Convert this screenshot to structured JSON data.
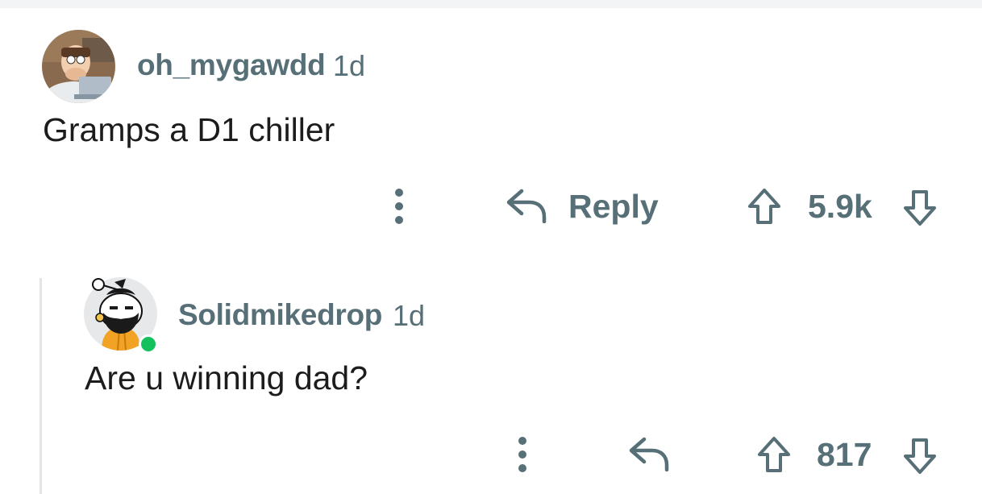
{
  "comments": [
    {
      "username": "oh_mygawdd",
      "time": "1d",
      "body": "Gramps a D1 chiller",
      "reply_label": "Reply",
      "score": "5.9k"
    },
    {
      "username": "Solidmikedrop",
      "time": "1d",
      "body": "Are u winning dad?",
      "score": "817",
      "online": true
    }
  ],
  "colors": {
    "meta_text": "#576f76",
    "body_text": "#1c1c1c",
    "thread_line": "#e3e6e8",
    "online": "#15c15d"
  },
  "icons": [
    "more-vertical-icon",
    "reply-arrow-icon",
    "upvote-icon",
    "downvote-icon"
  ]
}
